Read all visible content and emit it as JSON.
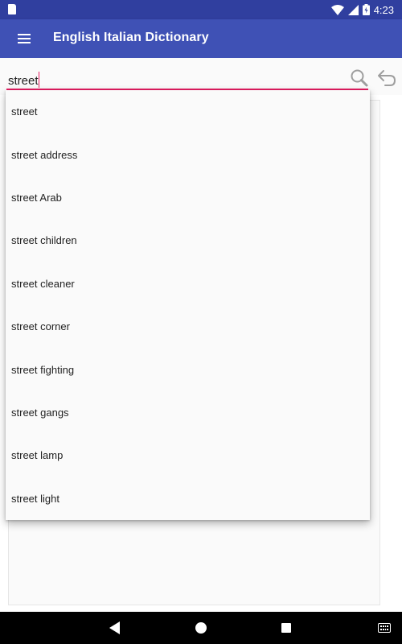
{
  "status_bar": {
    "time": "4:23",
    "icons": [
      "sd-card-icon",
      "wifi-icon",
      "signal-icon",
      "battery-charging-icon"
    ]
  },
  "app_bar": {
    "title": "English Italian Dictionary",
    "menu_icon": "menu-icon"
  },
  "search": {
    "value": "street",
    "search_icon": "search-icon",
    "back_icon": "undo-icon"
  },
  "suggestions": [
    "street",
    "street address",
    "street Arab",
    "street children",
    "street cleaner",
    "street corner",
    "street fighting",
    "street gangs",
    "street lamp",
    "street light"
  ],
  "nav_bar": {
    "icons": [
      "back-triangle-icon",
      "home-circle-icon",
      "recents-square-icon",
      "keyboard-icon"
    ]
  },
  "colors": {
    "app_bar": "#3f51b5",
    "status_bar": "#303f9f",
    "accent": "#e91e63"
  }
}
